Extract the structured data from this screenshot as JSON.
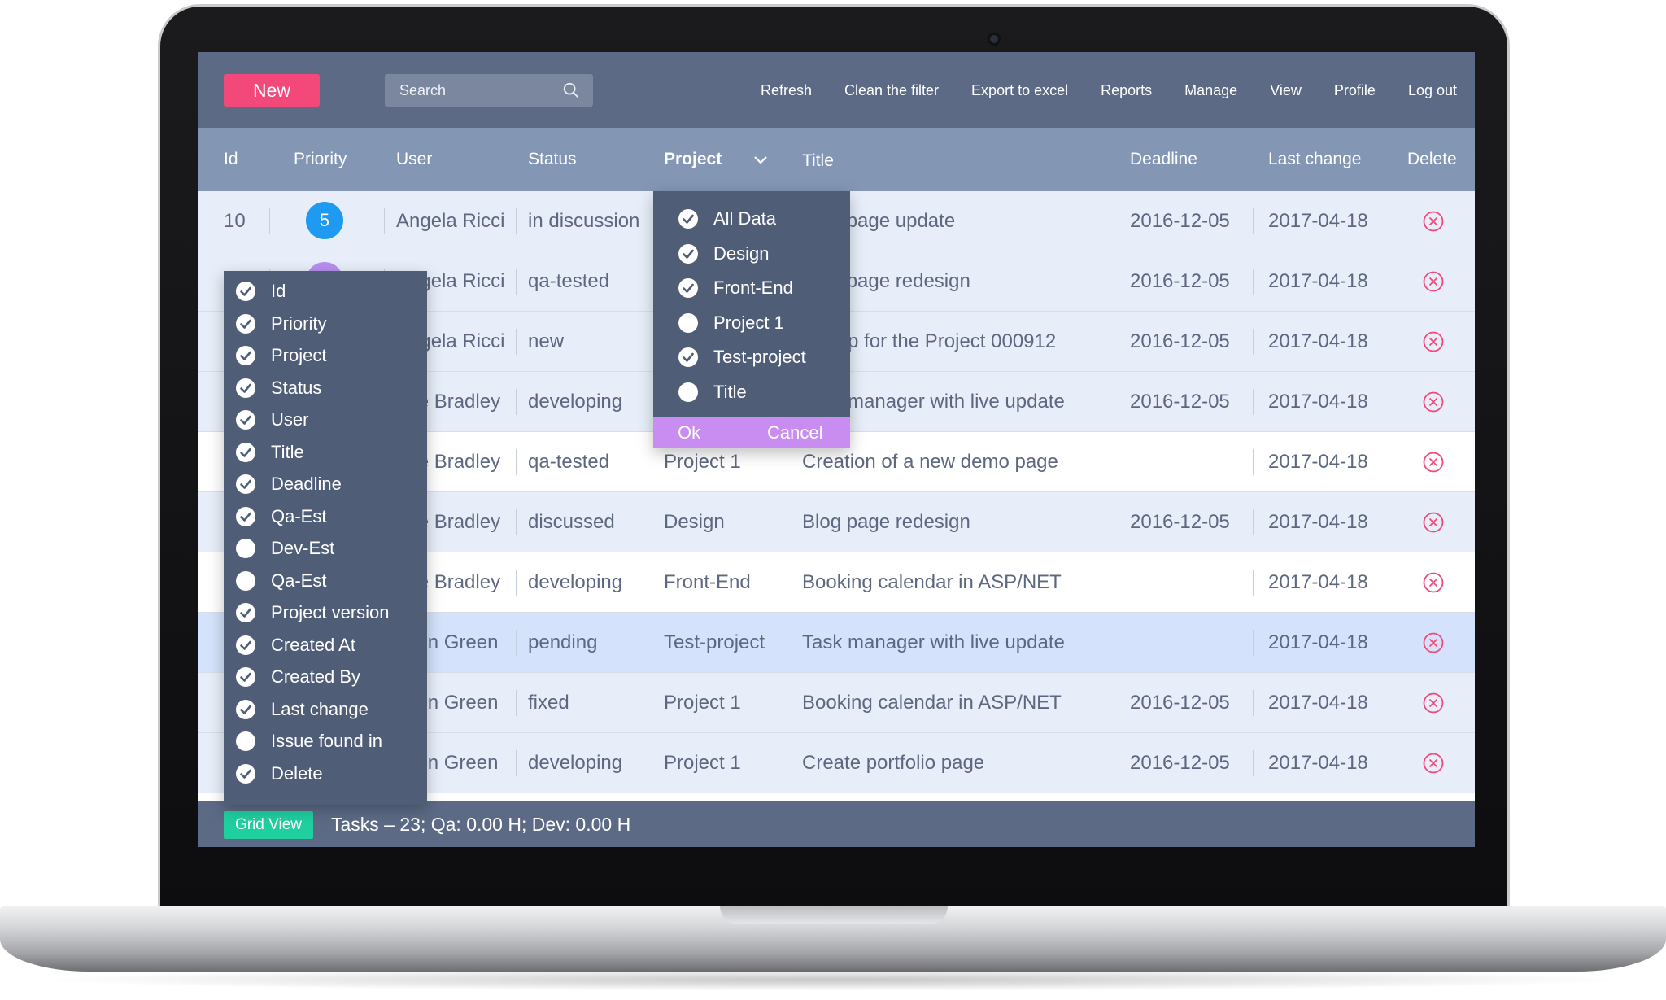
{
  "toolbar": {
    "new_label": "New",
    "search_placeholder": "Search",
    "menu": [
      "Refresh",
      "Clean the filter",
      "Export to excel",
      "Reports",
      "Manage",
      "View",
      "Profile",
      "Log out"
    ]
  },
  "table": {
    "headers": {
      "id": "Id",
      "priority": "Priority",
      "user": "User",
      "status": "Status",
      "project": "Project",
      "title": "Title",
      "deadline": "Deadline",
      "last_change": "Last change",
      "delete": "Delete"
    },
    "rows": [
      {
        "id": "10",
        "priority": "5",
        "priority_color": "#1e9af0",
        "user": "Angela Ricci",
        "status": "in discussion",
        "project": "",
        "title": "Blog page update",
        "deadline": "2016-12-05",
        "last_change": "2017-04-18"
      },
      {
        "id": "",
        "priority": "",
        "priority_color": "#b88ef0",
        "user": "Angela Ricci",
        "status": "qa-tested",
        "project": "",
        "title": "Blog page redesign",
        "deadline": "2016-12-05",
        "last_change": "2017-04-18"
      },
      {
        "id": "",
        "priority": "",
        "priority_color": "",
        "user": "Angela Ricci",
        "status": "new",
        "project": "",
        "title": "Set up for the Project 000912",
        "deadline": "2016-12-05",
        "last_change": "2017-04-18"
      },
      {
        "id": "",
        "priority": "",
        "priority_color": "",
        "user": "Lee Bradley",
        "status": "developing",
        "project": "",
        "title": "Task manager with live update",
        "deadline": "2016-12-05",
        "last_change": "2017-04-18"
      },
      {
        "id": "",
        "priority": "",
        "priority_color": "",
        "user": "Lee Bradley",
        "status": "qa-tested",
        "project": "Project 1",
        "title": "Creation of a new demo page",
        "deadline": "",
        "last_change": "2017-04-18"
      },
      {
        "id": "",
        "priority": "",
        "priority_color": "",
        "user": "Lee Bradley",
        "status": "discussed",
        "project": "Design",
        "title": "Blog page redesign",
        "deadline": "2016-12-05",
        "last_change": "2017-04-18"
      },
      {
        "id": "",
        "priority": "",
        "priority_color": "",
        "user": "Lee Bradley",
        "status": "developing",
        "project": "Front-End",
        "title": "Booking calendar in ASP/NET",
        "deadline": "",
        "last_change": "2017-04-18"
      },
      {
        "id": "",
        "priority": "",
        "priority_color": "",
        "user": "John Green",
        "status": "pending",
        "project": "Test-project",
        "title": "Task manager with live update",
        "deadline": "",
        "last_change": "2017-04-18"
      },
      {
        "id": "",
        "priority": "",
        "priority_color": "",
        "user": "John Green",
        "status": "fixed",
        "project": "Project 1",
        "title": "Booking calendar in ASP/NET",
        "deadline": "2016-12-05",
        "last_change": "2017-04-18"
      },
      {
        "id": "",
        "priority": "",
        "priority_color": "",
        "user": "John Green",
        "status": "developing",
        "project": "Project 1",
        "title": "Create portfolio page",
        "deadline": "2016-12-05",
        "last_change": "2017-04-18"
      }
    ]
  },
  "columns_menu": [
    {
      "label": "Id",
      "checked": true
    },
    {
      "label": "Priority",
      "checked": true
    },
    {
      "label": "Project",
      "checked": true
    },
    {
      "label": "Status",
      "checked": true
    },
    {
      "label": "User",
      "checked": true
    },
    {
      "label": "Title",
      "checked": true
    },
    {
      "label": "Deadline",
      "checked": true
    },
    {
      "label": "Qa-Est",
      "checked": true
    },
    {
      "label": "Dev-Est",
      "checked": false
    },
    {
      "label": "Qa-Est",
      "checked": false
    },
    {
      "label": "Project version",
      "checked": true
    },
    {
      "label": "Created At",
      "checked": true
    },
    {
      "label": "Created By",
      "checked": true
    },
    {
      "label": "Last change",
      "checked": true
    },
    {
      "label": "Issue found in",
      "checked": false
    },
    {
      "label": "Delete",
      "checked": true
    }
  ],
  "project_filter": {
    "items": [
      {
        "label": "All Data",
        "checked": true
      },
      {
        "label": "Design",
        "checked": true
      },
      {
        "label": "Front-End",
        "checked": true
      },
      {
        "label": "Project 1",
        "checked": false
      },
      {
        "label": "Test-project",
        "checked": true
      },
      {
        "label": "Title",
        "checked": false
      }
    ],
    "ok_label": "Ok",
    "cancel_label": "Cancel"
  },
  "footer": {
    "grid_view_label": "Grid View",
    "stats": "Tasks – 23; Qa: 0.00 H; Dev: 0.00 H"
  },
  "colors": {
    "topbar": "#5c6a85",
    "header": "#8396b4",
    "new_button": "#f2487a",
    "grid_view_button": "#20cfa0",
    "dropdown_bg": "#505d77",
    "dropdown_actions": "#c98cf0",
    "delete_icon": "#f2487a",
    "selected_row": "#d4e3fb"
  }
}
